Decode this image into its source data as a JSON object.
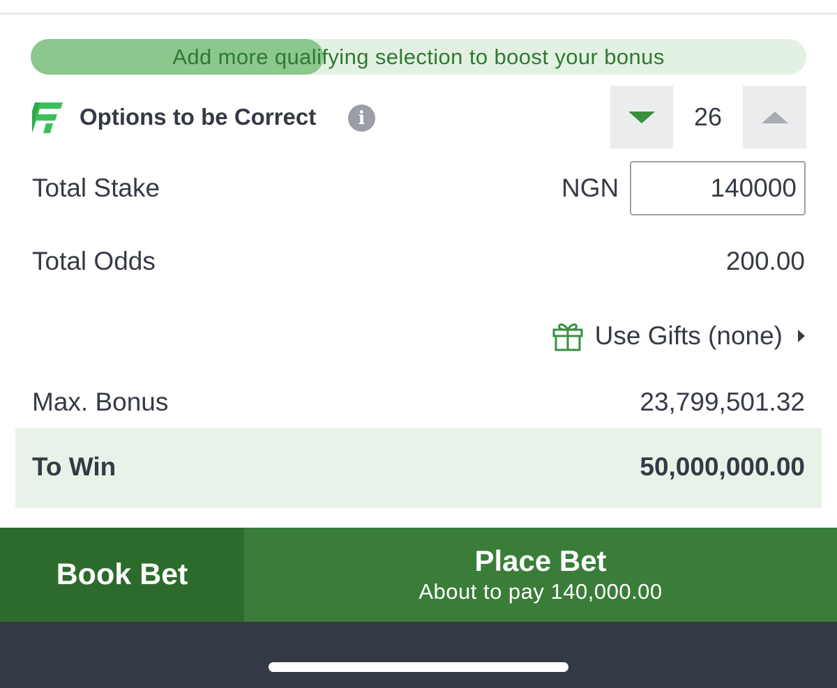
{
  "colors": {
    "brand_green": "#3a7d38",
    "brand_green_dark": "#2d6b2d",
    "progress_fill": "#8cc78e",
    "progress_track": "#e3f1e3",
    "to_win_band": "#e7f3e8",
    "bottom_bar": "#343a45"
  },
  "bonus_banner": {
    "text": "Add more qualifying selection to boost your bonus",
    "progress_fraction": 0.378
  },
  "options": {
    "label": "Options to be Correct",
    "logo_icon": "brand-f-logo-icon",
    "info_icon": "info-icon",
    "value": "26",
    "decrement_icon": "triangle-down-icon",
    "increment_icon": "triangle-up-icon"
  },
  "stake": {
    "label": "Total Stake",
    "currency": "NGN",
    "value": "140000"
  },
  "odds": {
    "label": "Total Odds",
    "value": "200.00"
  },
  "gifts": {
    "icon": "gift-icon",
    "label": "Use Gifts (none)",
    "chevron_icon": "caret-right-icon"
  },
  "bonus": {
    "label": "Max. Bonus",
    "value": "23,799,501.32"
  },
  "to_win": {
    "label": "To Win",
    "value": "50,000,000.00"
  },
  "actions": {
    "book_bet": "Book Bet",
    "place_bet": "Place Bet",
    "place_bet_sub": "About to pay 140,000.00"
  }
}
